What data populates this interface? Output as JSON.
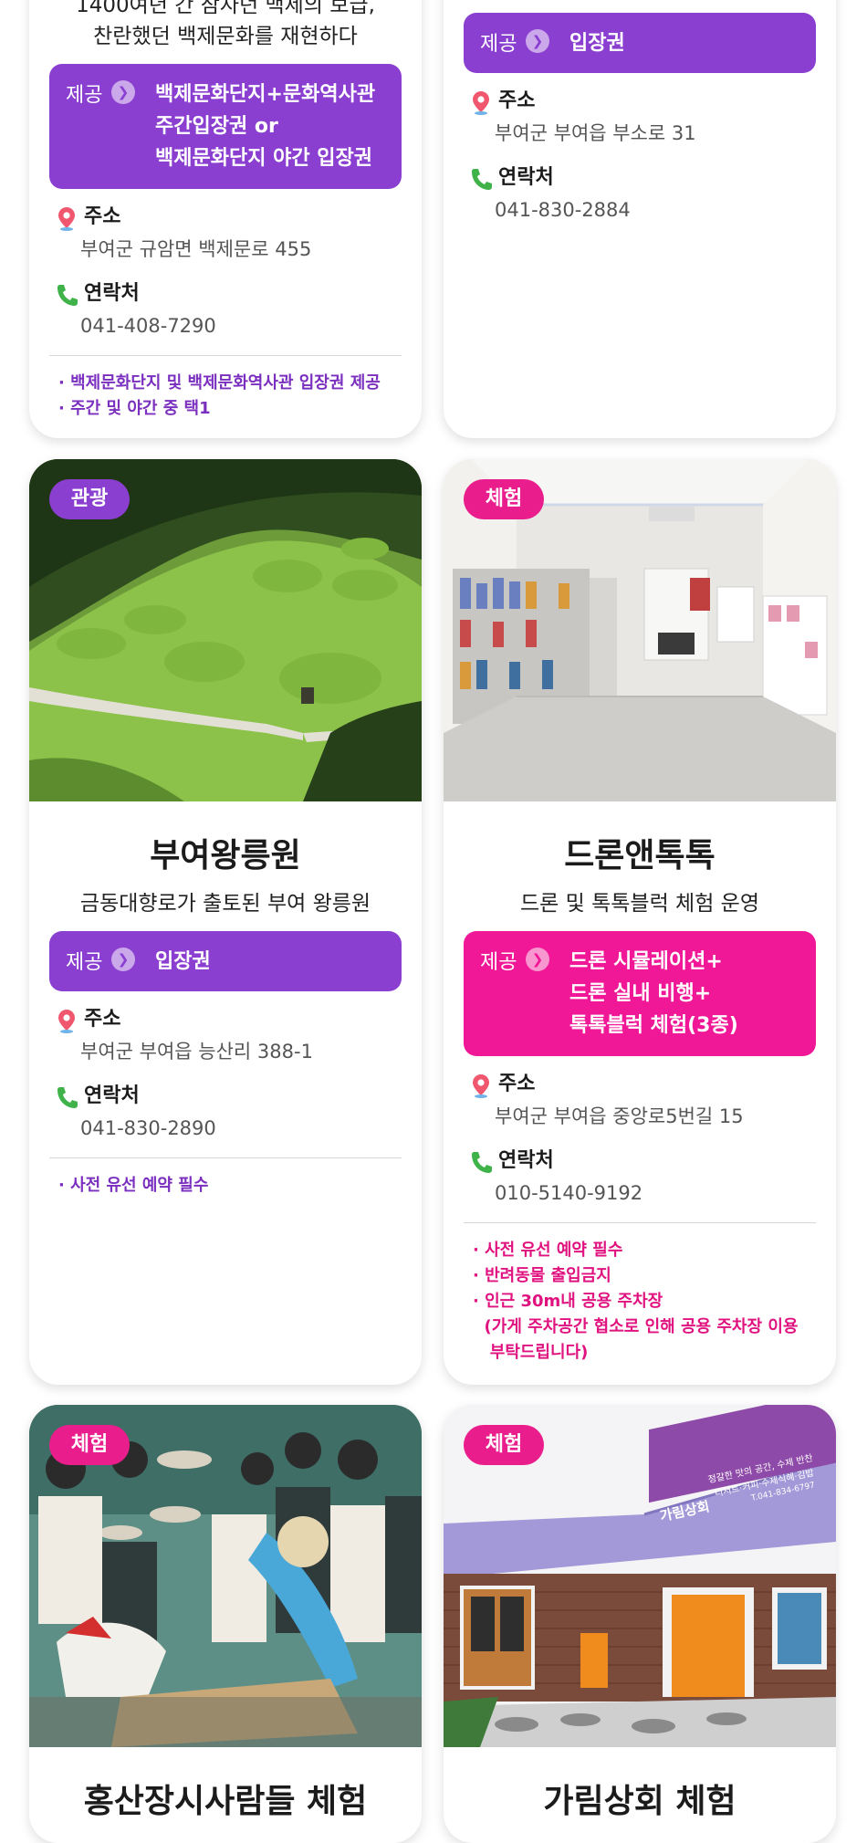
{
  "colors": {
    "purple": "#8b3fd1",
    "pink": "#f01896"
  },
  "card_top_left": {
    "subtitle_line1": "1400여년 간 잠자던 백제의 보급,",
    "subtitle_line2": "찬란했던 백제문화를 재현하다",
    "offer_label": "제공",
    "offer_lines": [
      "백제문화단지+문화역사관",
      "주간입장권 or",
      "백제문화단지 야간 입장권"
    ],
    "address_label": "주소",
    "address": "부여군 규암면 백제문로 455",
    "contact_label": "연락처",
    "contact": "041-408-7290",
    "notes": [
      "· 백제문화단지 및 백제문화역사관 입장권 제공",
      "· 주간 및 야간 중 택1"
    ]
  },
  "card_top_right": {
    "offer_label": "제공",
    "offer_lines": [
      "입장권"
    ],
    "address_label": "주소",
    "address": "부여군 부여읍 부소로 31",
    "contact_label": "연락처",
    "contact": "041-830-2884"
  },
  "card_royal_tombs": {
    "badge": "관광",
    "title": "부여왕릉원",
    "subtitle": "금동대향로가 출토된 부여 왕릉원",
    "offer_label": "제공",
    "offer_lines": [
      "입장권"
    ],
    "address_label": "주소",
    "address": "부여군 부여읍 능산리 388-1",
    "contact_label": "연락처",
    "contact": "041-830-2890",
    "notes": [
      "· 사전 유선 예약 필수"
    ]
  },
  "card_drone": {
    "badge": "체험",
    "title": "드론앤톡톡",
    "subtitle": "드론 및 톡톡블럭 체험 운영",
    "offer_label": "제공",
    "offer_lines": [
      "드론 시뮬레이션+",
      "드론 실내 비행+",
      "톡톡블럭 체험(3종)"
    ],
    "address_label": "주소",
    "address": "부여군 부여읍 중앙로5번길 15",
    "contact_label": "연락처",
    "contact": "010-5140-9192",
    "notes": [
      "· 사전 유선 예약 필수",
      "· 반려동물 출입금지",
      "· 인근 30m내 공용 주차장",
      "  (가게 주차공간 협소로 인해 공용 주차장 이용",
      "   부탁드립니다)"
    ]
  },
  "card_bottom_left": {
    "badge": "체험",
    "title": "홍산장시사람들 체험"
  },
  "card_bottom_right": {
    "badge": "체험",
    "title": "가림상회 체험",
    "sign_name": "가림상회",
    "sign_line1": "정갈한 맛의 공간, 수제 반찬",
    "sign_line2": "디저트·커피·수제식혜·김밥",
    "sign_phone": "T.041-834-6797"
  }
}
